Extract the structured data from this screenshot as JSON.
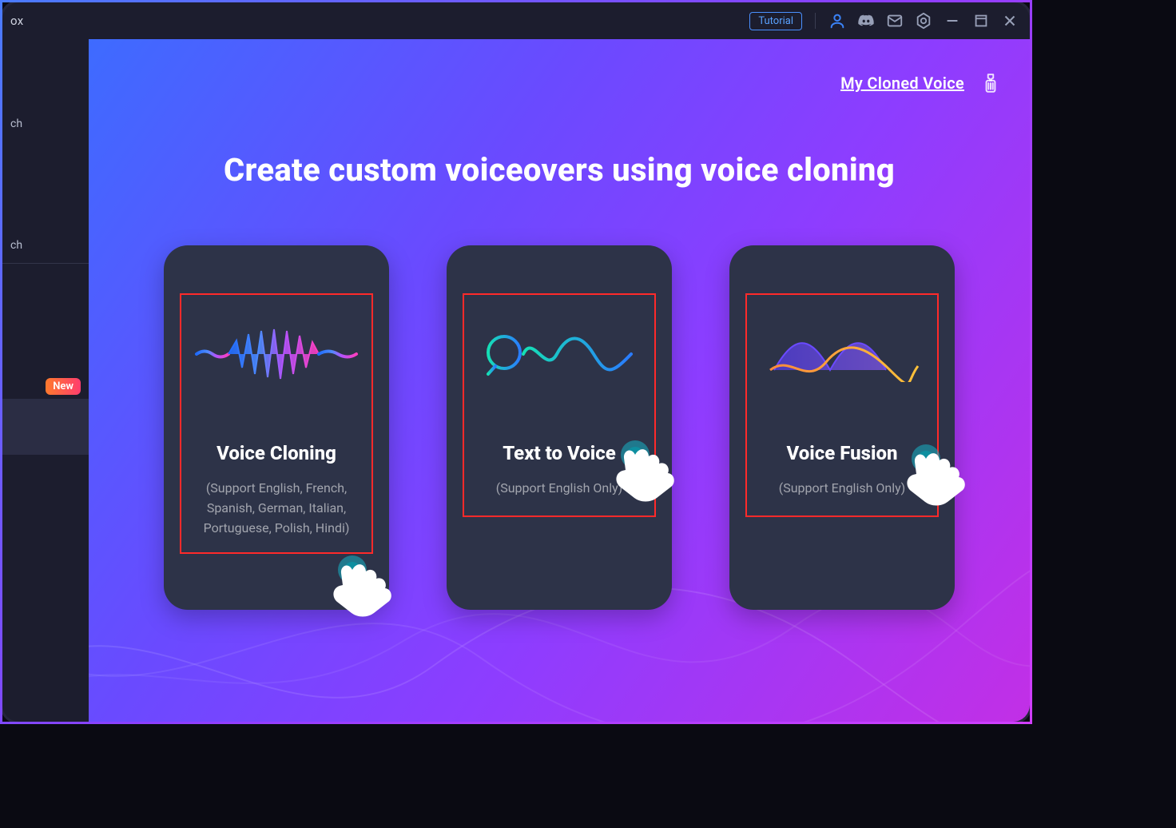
{
  "titlebar": {
    "title_fragment": "ox",
    "tutorial_label": "Tutorial"
  },
  "sidebar": {
    "fragment_a": "ch",
    "fragment_b": "ch",
    "new_badge": "New"
  },
  "top_actions": {
    "my_cloned_voice": "My Cloned Voice"
  },
  "page": {
    "heading": "Create custom voiceovers using voice cloning"
  },
  "cards": [
    {
      "title": "Voice Cloning",
      "subtitle": "(Support English, French, Spanish, German, Italian, Portuguese, Polish, Hindi)"
    },
    {
      "title": "Text to Voice",
      "subtitle": "(Support English Only)"
    },
    {
      "title": "Voice Fusion",
      "subtitle": "(Support English Only)"
    }
  ],
  "colors": {
    "accent_blue": "#3b82f6",
    "card_bg": "#2d3348",
    "highlight_red": "#ff2a2a"
  }
}
